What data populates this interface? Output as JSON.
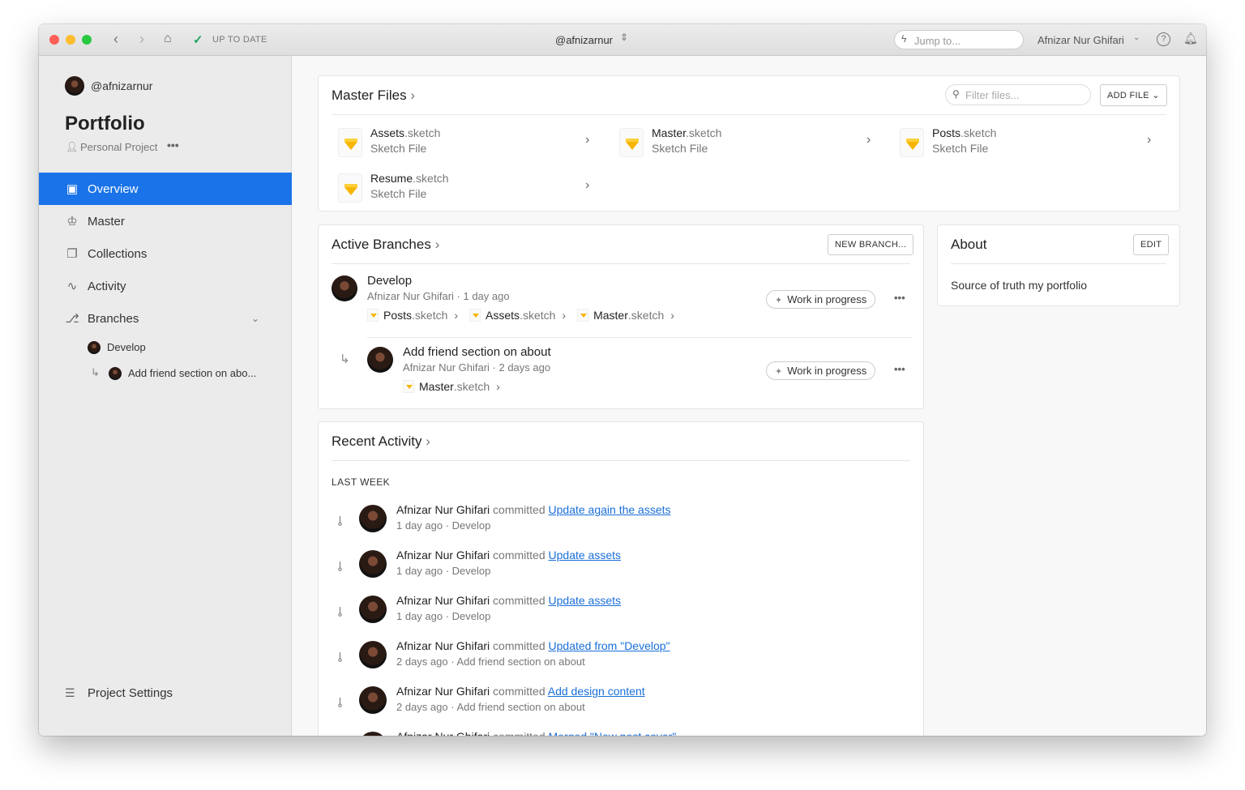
{
  "titlebar": {
    "status": "UP TO DATE",
    "account": "@afnizarnur",
    "jump_placeholder": "Jump to...",
    "user": "Afnizar Nur Ghifari"
  },
  "sidebar": {
    "username": "@afnizarnur",
    "project": "Portfolio",
    "project_type": "Personal Project",
    "nav": [
      {
        "label": "Overview",
        "icon": "document-icon"
      },
      {
        "label": "Master",
        "icon": "crown-icon"
      },
      {
        "label": "Collections",
        "icon": "collections-icon"
      },
      {
        "label": "Activity",
        "icon": "activity-icon"
      },
      {
        "label": "Branches",
        "icon": "branch-icon"
      }
    ],
    "branches": [
      "Develop",
      "Add friend section on abo..."
    ],
    "settings": "Project Settings"
  },
  "master_files": {
    "title": "Master Files",
    "filter_placeholder": "Filter files...",
    "add_file": "ADD FILE",
    "files": [
      {
        "name": "Assets",
        "ext": ".sketch",
        "type": "Sketch File"
      },
      {
        "name": "Master",
        "ext": ".sketch",
        "type": "Sketch File"
      },
      {
        "name": "Posts",
        "ext": ".sketch",
        "type": "Sketch File"
      },
      {
        "name": "Resume",
        "ext": ".sketch",
        "type": "Sketch File"
      }
    ]
  },
  "branches": {
    "title": "Active Branches",
    "new_branch": "NEW BRANCH...",
    "items": [
      {
        "name": "Develop",
        "meta": "Afnizar Nur Ghifari · 1 day ago",
        "status": "Work in progress",
        "files": [
          [
            "Posts",
            ".sketch"
          ],
          [
            "Assets",
            ".sketch"
          ],
          [
            "Master",
            ".sketch"
          ]
        ]
      },
      {
        "name": "Add friend section on about",
        "meta": "Afnizar Nur Ghifari · 2 days ago",
        "status": "Work in progress",
        "files": [
          [
            "Master",
            ".sketch"
          ]
        ]
      }
    ]
  },
  "about": {
    "title": "About",
    "edit": "EDIT",
    "text": "Source of truth my portfolio"
  },
  "activity": {
    "title": "Recent Activity",
    "group": "LAST WEEK",
    "verb": "committed",
    "items": [
      {
        "user": "Afnizar Nur Ghifari",
        "commit": "Update again the assets",
        "meta": "1 day ago · Develop"
      },
      {
        "user": "Afnizar Nur Ghifari",
        "commit": "Update assets",
        "meta": "1 day ago · Develop"
      },
      {
        "user": "Afnizar Nur Ghifari",
        "commit": "Update assets",
        "meta": "1 day ago · Develop"
      },
      {
        "user": "Afnizar Nur Ghifari",
        "commit": "Updated from \"Develop\"",
        "meta": "2 days ago · Add friend section on about"
      },
      {
        "user": "Afnizar Nur Ghifari",
        "commit": "Add design content",
        "meta": "2 days ago · Add friend section on about"
      },
      {
        "user": "Afnizar Nur Ghifari",
        "commit": "Merged \"New post cover\"",
        "meta": ""
      }
    ]
  }
}
